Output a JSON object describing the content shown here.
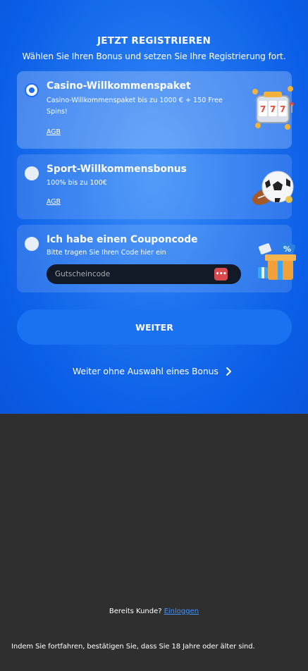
{
  "header": {
    "title": "JETZT REGISTRIEREN",
    "subtitle": "Wählen Sie Ihren Bonus und setzen Sie Ihre Registrierung fort."
  },
  "bonuses": [
    {
      "title": "Casino-Willkommenspaket",
      "description": "Casino-Willkommenspaket bis zu 1000 € + 150 Free Spins!",
      "terms_link": "AGB",
      "selected": true,
      "icon": "slot-machine-icon"
    },
    {
      "title": "Sport-Willkommensbonus",
      "description": "100% bis zu 100€",
      "terms_link": "AGB",
      "selected": false,
      "icon": "sports-balls-icon"
    },
    {
      "title": "Ich habe einen Couponcode",
      "description": "Bitte tragen Sie Ihren Code hier ein",
      "coupon_placeholder": "Gutscheincode",
      "coupon_value": "",
      "selected": false,
      "icon": "gift-box-icon"
    }
  ],
  "actions": {
    "continue_label": "WEITER",
    "skip_label": "Weiter ohne Auswahl eines Bonus"
  },
  "footer": {
    "already_customer": "Bereits Kunde?",
    "login_link": "Einloggen",
    "age_notice": "Indem Sie fortfahren, bestätigen Sie, dass Sie 18 Jahre oder älter sind."
  },
  "colors": {
    "primary_blue": "#1a72f2",
    "background_dark": "#2f2f2f",
    "link_blue": "#3f93ff",
    "password_manager_red": "#d84a4e"
  }
}
